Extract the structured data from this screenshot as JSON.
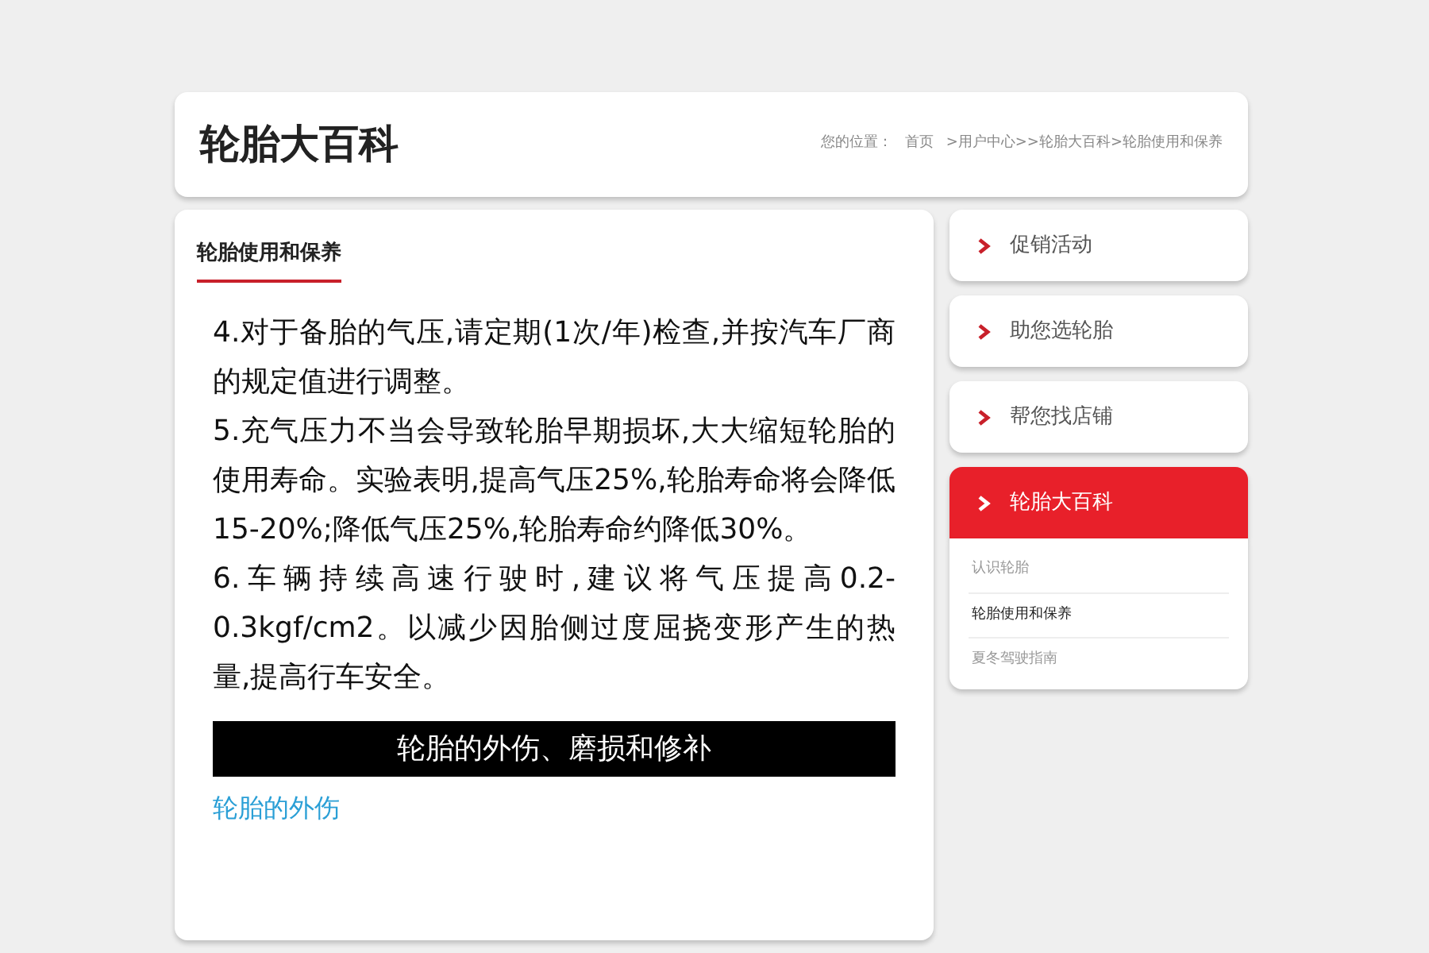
{
  "header": {
    "title": "轮胎大百科",
    "breadcrumb_label": "您的位置：",
    "breadcrumb": [
      "首页",
      ">用户中心>>轮胎大百科>轮胎使用和保养"
    ]
  },
  "article": {
    "section_title": "轮胎使用和保养",
    "paragraphs": [
      "4.对于备胎的气压,请定期(1次/年)检查,并按汽车厂商的规定值进行调整。",
      "5.充气压力不当会导致轮胎早期损坏,大大缩短轮胎的使用寿命。实验表明,提高气压25%,轮胎寿命将会降低15-20%;降低气压25%,轮胎寿命约降低30%。",
      "6.车辆持续高速行驶时,建议将气压提高0.2-0.3kgf/cm2。以减少因胎侧过度屈挠变形产生的热量,提高行车安全。"
    ],
    "banner": "轮胎的外伤、磨损和修补",
    "subheading": "轮胎的外伤"
  },
  "sidebar": {
    "items": [
      {
        "label": "促销活动",
        "selected": false
      },
      {
        "label": "助您选轮胎",
        "selected": false
      },
      {
        "label": "帮您找店铺",
        "selected": false
      },
      {
        "label": "轮胎大百科",
        "selected": true,
        "children": [
          {
            "label": "认识轮胎",
            "selected": false
          },
          {
            "label": "轮胎使用和保养",
            "selected": true
          },
          {
            "label": "夏冬驾驶指南",
            "selected": false
          }
        ]
      }
    ]
  }
}
